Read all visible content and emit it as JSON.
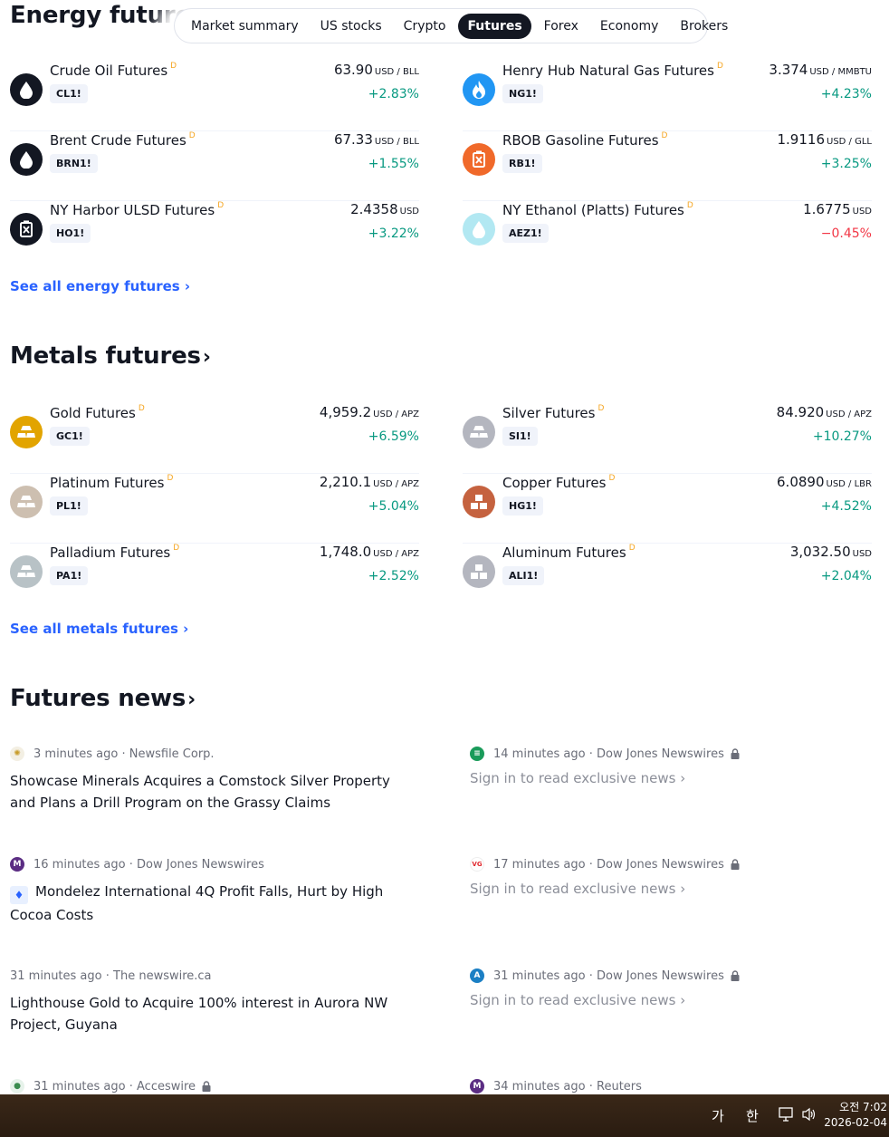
{
  "tabs": [
    "Market summary",
    "US stocks",
    "Crypto",
    "Futures",
    "Forex",
    "Economy",
    "Brokers"
  ],
  "active_tab": "Futures",
  "energy": {
    "title": "Energy futures",
    "see_all": "See all energy futures ›",
    "items": [
      {
        "name": "Crude Oil Futures",
        "flag": "D",
        "ticker": "CL1!",
        "price": "63.90",
        "unit": "USD / BLL",
        "change": "+2.83%",
        "icon": "oil-drop-icon"
      },
      {
        "name": "Henry Hub Natural Gas Futures",
        "flag": "D",
        "ticker": "NG1!",
        "price": "3.374",
        "unit": "USD / MMBTU",
        "change": "+4.23%",
        "icon": "flame-icon"
      },
      {
        "name": "Brent Crude Futures",
        "flag": "D",
        "ticker": "BRN1!",
        "price": "67.33",
        "unit": "USD / BLL",
        "change": "+1.55%",
        "icon": "oil-drop-icon"
      },
      {
        "name": "RBOB Gasoline Futures",
        "flag": "D",
        "ticker": "RB1!",
        "price": "1.9116",
        "unit": "USD / GLL",
        "change": "+3.25%",
        "icon": "fuel-can-icon"
      },
      {
        "name": "NY Harbor ULSD Futures",
        "flag": "D",
        "ticker": "HO1!",
        "price": "2.4358",
        "unit": "USD",
        "change": "+3.22%",
        "icon": "fuel-can-icon"
      },
      {
        "name": "NY Ethanol (Platts) Futures",
        "flag": "D",
        "ticker": "AEZ1!",
        "price": "1.6775",
        "unit": "USD",
        "change": "−0.45%",
        "icon": "ethanol-drop-icon"
      }
    ]
  },
  "metals": {
    "title": "Metals futures",
    "chevron": "›",
    "see_all": "See all metals futures ›",
    "items": [
      {
        "name": "Gold Futures",
        "flag": "D",
        "ticker": "GC1!",
        "price": "4,959.2",
        "unit": "USD / APZ",
        "change": "+6.59%",
        "icon": "gold-bars-icon"
      },
      {
        "name": "Silver Futures",
        "flag": "D",
        "ticker": "SI1!",
        "price": "84.920",
        "unit": "USD / APZ",
        "change": "+10.27%",
        "icon": "silver-bars-icon"
      },
      {
        "name": "Platinum Futures",
        "flag": "D",
        "ticker": "PL1!",
        "price": "2,210.1",
        "unit": "USD / APZ",
        "change": "+5.04%",
        "icon": "platinum-bars-icon"
      },
      {
        "name": "Copper Futures",
        "flag": "D",
        "ticker": "HG1!",
        "price": "6.0890",
        "unit": "USD / LBR",
        "change": "+4.52%",
        "icon": "copper-blocks-icon"
      },
      {
        "name": "Palladium Futures",
        "flag": "D",
        "ticker": "PA1!",
        "price": "1,748.0",
        "unit": "USD / APZ",
        "change": "+2.52%",
        "icon": "palladium-bars-icon"
      },
      {
        "name": "Aluminum Futures",
        "flag": "D",
        "ticker": "ALI1!",
        "price": "3,032.50",
        "unit": "USD",
        "change": "+2.04%",
        "icon": "aluminum-blocks-icon"
      }
    ]
  },
  "news": {
    "title": "Futures news",
    "chevron": "›",
    "items": [
      {
        "time": "3 minutes ago",
        "source": "Newsfile Corp.",
        "headline": "Showcase Minerals Acquires a Comstock Silver Property and Plans a Drill Program on the Grassy Claims",
        "locked": false
      },
      {
        "time": "14 minutes ago",
        "source": "Dow Jones Newswires",
        "headline": "Sign in to read exclusive news ›",
        "locked": true
      },
      {
        "time": "16 minutes ago",
        "source": "Dow Jones Newswires",
        "headline": "Mondelez International 4Q Profit Falls, Hurt by High Cocoa Costs",
        "locked": false
      },
      {
        "time": "17 minutes ago",
        "source": "Dow Jones Newswires",
        "headline": "Sign in to read exclusive news ›",
        "locked": true
      },
      {
        "time": "31 minutes ago",
        "source": "The newswire.ca",
        "headline": "Lighthouse Gold to Acquire 100% interest in Aurora NW Project, Guyana",
        "locked": false
      },
      {
        "time": "31 minutes ago",
        "source": "Dow Jones Newswires",
        "headline": "Sign in to read exclusive news ›",
        "locked": true
      },
      {
        "time": "31 minutes ago",
        "source": "Acceswire",
        "headline": "",
        "locked": true
      },
      {
        "time": "34 minutes ago",
        "source": "Reuters",
        "headline": "",
        "locked": false
      }
    ]
  },
  "taskbar": {
    "ime_1": "가",
    "ime_2": "한",
    "clock_time": "오전 7:02",
    "clock_date": "2026-02-04"
  },
  "colors": {
    "up": "#089981",
    "down": "#f23645",
    "link": "#2962ff",
    "tab_active": "#131722"
  }
}
